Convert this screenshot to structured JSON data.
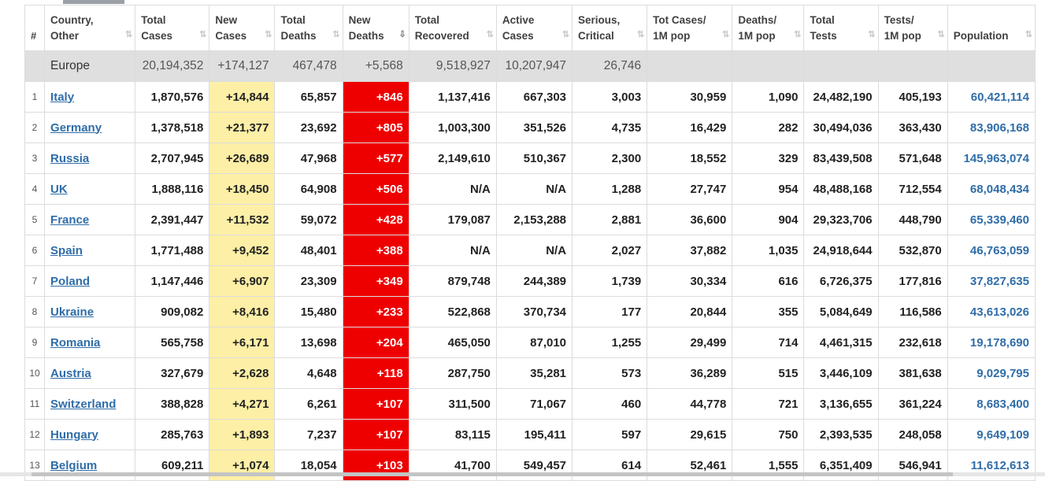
{
  "header": [
    {
      "l1": "",
      "l2": "#"
    },
    {
      "l1": "Country,",
      "l2": "Other"
    },
    {
      "l1": "Total",
      "l2": "Cases"
    },
    {
      "l1": "New",
      "l2": "Cases"
    },
    {
      "l1": "Total",
      "l2": "Deaths"
    },
    {
      "l1": "New",
      "l2": "Deaths"
    },
    {
      "l1": "Total",
      "l2": "Recovered"
    },
    {
      "l1": "Active",
      "l2": "Cases"
    },
    {
      "l1": "Serious,",
      "l2": "Critical"
    },
    {
      "l1": "Tot Cases/",
      "l2": "1M pop"
    },
    {
      "l1": "Deaths/",
      "l2": "1M pop"
    },
    {
      "l1": "Total",
      "l2": "Tests"
    },
    {
      "l1": "Tests/",
      "l2": "1M pop"
    },
    {
      "l1": "",
      "l2": "Population"
    }
  ],
  "sort_icon": "⇅",
  "sort_active_icon": "⇩",
  "total_row": {
    "region": "Europe",
    "total_cases": "20,194,352",
    "new_cases": "+174,127",
    "total_deaths": "467,478",
    "new_deaths": "+5,568",
    "total_recovered": "9,518,927",
    "active_cases": "10,207,947",
    "serious": "26,746",
    "cases_per_m": "",
    "deaths_per_m": "",
    "total_tests": "",
    "tests_per_m": "",
    "population": ""
  },
  "rows": [
    {
      "num": "1",
      "country": "Italy",
      "total_cases": "1,870,576",
      "new_cases": "+14,844",
      "total_deaths": "65,857",
      "new_deaths": "+846",
      "recovered": "1,137,416",
      "active": "667,303",
      "serious": "3,003",
      "cases_per_m": "30,959",
      "deaths_per_m": "1,090",
      "tests": "24,482,190",
      "tests_per_m": "405,193",
      "population": "60,421,114"
    },
    {
      "num": "2",
      "country": "Germany",
      "total_cases": "1,378,518",
      "new_cases": "+21,377",
      "total_deaths": "23,692",
      "new_deaths": "+805",
      "recovered": "1,003,300",
      "active": "351,526",
      "serious": "4,735",
      "cases_per_m": "16,429",
      "deaths_per_m": "282",
      "tests": "30,494,036",
      "tests_per_m": "363,430",
      "population": "83,906,168"
    },
    {
      "num": "3",
      "country": "Russia",
      "total_cases": "2,707,945",
      "new_cases": "+26,689",
      "total_deaths": "47,968",
      "new_deaths": "+577",
      "recovered": "2,149,610",
      "active": "510,367",
      "serious": "2,300",
      "cases_per_m": "18,552",
      "deaths_per_m": "329",
      "tests": "83,439,508",
      "tests_per_m": "571,648",
      "population": "145,963,074"
    },
    {
      "num": "4",
      "country": "UK",
      "total_cases": "1,888,116",
      "new_cases": "+18,450",
      "total_deaths": "64,908",
      "new_deaths": "+506",
      "recovered": "N/A",
      "active": "N/A",
      "serious": "1,288",
      "cases_per_m": "27,747",
      "deaths_per_m": "954",
      "tests": "48,488,168",
      "tests_per_m": "712,554",
      "population": "68,048,434"
    },
    {
      "num": "5",
      "country": "France",
      "total_cases": "2,391,447",
      "new_cases": "+11,532",
      "total_deaths": "59,072",
      "new_deaths": "+428",
      "recovered": "179,087",
      "active": "2,153,288",
      "serious": "2,881",
      "cases_per_m": "36,600",
      "deaths_per_m": "904",
      "tests": "29,323,706",
      "tests_per_m": "448,790",
      "population": "65,339,460"
    },
    {
      "num": "6",
      "country": "Spain",
      "total_cases": "1,771,488",
      "new_cases": "+9,452",
      "total_deaths": "48,401",
      "new_deaths": "+388",
      "recovered": "N/A",
      "active": "N/A",
      "serious": "2,027",
      "cases_per_m": "37,882",
      "deaths_per_m": "1,035",
      "tests": "24,918,644",
      "tests_per_m": "532,870",
      "population": "46,763,059"
    },
    {
      "num": "7",
      "country": "Poland",
      "total_cases": "1,147,446",
      "new_cases": "+6,907",
      "total_deaths": "23,309",
      "new_deaths": "+349",
      "recovered": "879,748",
      "active": "244,389",
      "serious": "1,739",
      "cases_per_m": "30,334",
      "deaths_per_m": "616",
      "tests": "6,726,375",
      "tests_per_m": "177,816",
      "population": "37,827,635"
    },
    {
      "num": "8",
      "country": "Ukraine",
      "total_cases": "909,082",
      "new_cases": "+8,416",
      "total_deaths": "15,480",
      "new_deaths": "+233",
      "recovered": "522,868",
      "active": "370,734",
      "serious": "177",
      "cases_per_m": "20,844",
      "deaths_per_m": "355",
      "tests": "5,084,649",
      "tests_per_m": "116,586",
      "population": "43,613,026"
    },
    {
      "num": "9",
      "country": "Romania",
      "total_cases": "565,758",
      "new_cases": "+6,171",
      "total_deaths": "13,698",
      "new_deaths": "+204",
      "recovered": "465,050",
      "active": "87,010",
      "serious": "1,255",
      "cases_per_m": "29,499",
      "deaths_per_m": "714",
      "tests": "4,461,315",
      "tests_per_m": "232,618",
      "population": "19,178,690"
    },
    {
      "num": "10",
      "country": "Austria",
      "total_cases": "327,679",
      "new_cases": "+2,628",
      "total_deaths": "4,648",
      "new_deaths": "+118",
      "recovered": "287,750",
      "active": "35,281",
      "serious": "573",
      "cases_per_m": "36,289",
      "deaths_per_m": "515",
      "tests": "3,446,109",
      "tests_per_m": "381,638",
      "population": "9,029,795"
    },
    {
      "num": "11",
      "country": "Switzerland",
      "total_cases": "388,828",
      "new_cases": "+4,271",
      "total_deaths": "6,261",
      "new_deaths": "+107",
      "recovered": "311,500",
      "active": "71,067",
      "serious": "460",
      "cases_per_m": "44,778",
      "deaths_per_m": "721",
      "tests": "3,136,655",
      "tests_per_m": "361,224",
      "population": "8,683,400"
    },
    {
      "num": "12",
      "country": "Hungary",
      "total_cases": "285,763",
      "new_cases": "+1,893",
      "total_deaths": "7,237",
      "new_deaths": "+107",
      "recovered": "83,115",
      "active": "195,411",
      "serious": "597",
      "cases_per_m": "29,615",
      "deaths_per_m": "750",
      "tests": "2,393,535",
      "tests_per_m": "248,058",
      "population": "9,649,109"
    },
    {
      "num": "13",
      "country": "Belgium",
      "total_cases": "609,211",
      "new_cases": "+1,074",
      "total_deaths": "18,054",
      "new_deaths": "+103",
      "recovered": "41,700",
      "active": "549,457",
      "serious": "614",
      "cases_per_m": "52,461",
      "deaths_per_m": "1,555",
      "tests": "6,351,409",
      "tests_per_m": "546,941",
      "population": "11,612,613"
    }
  ]
}
